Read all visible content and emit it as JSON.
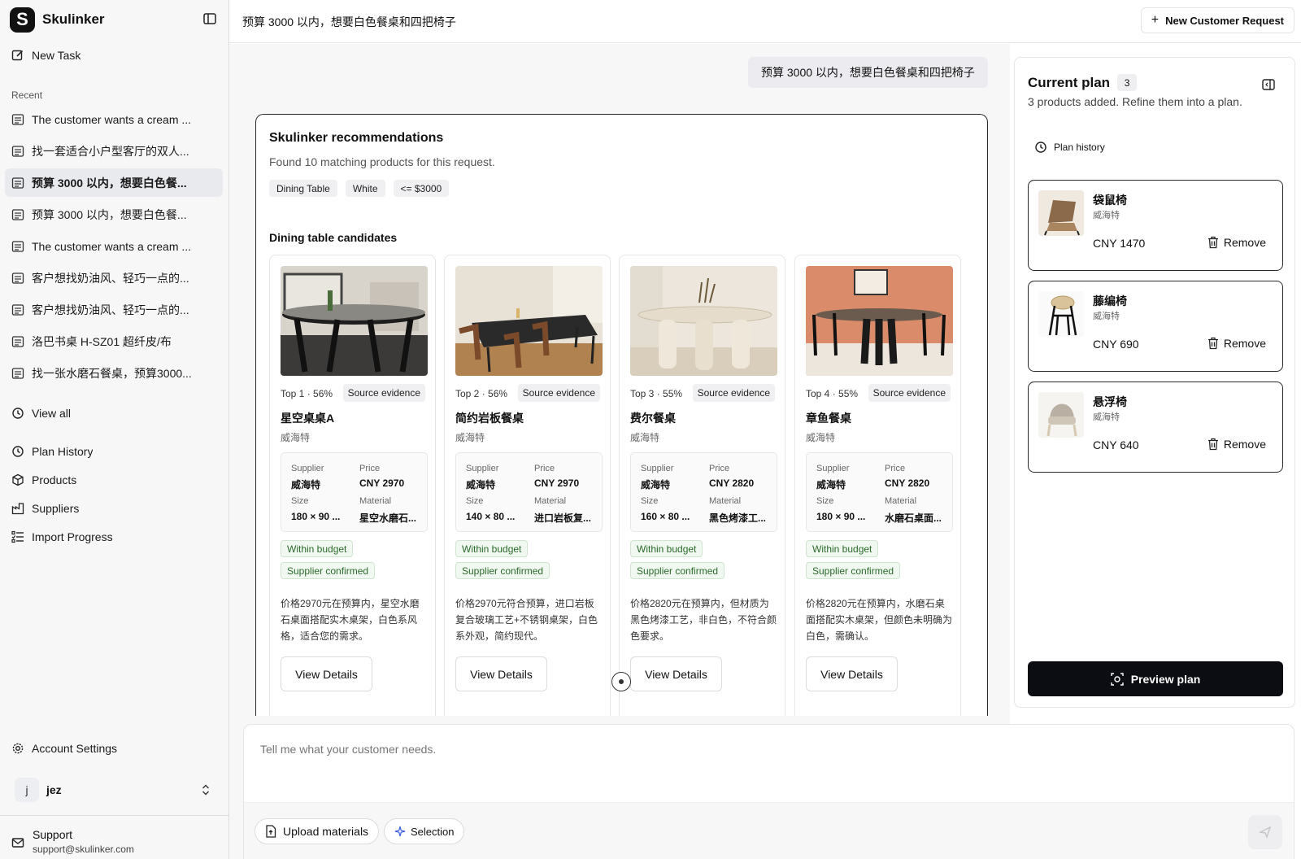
{
  "app": {
    "name": "Skulinker",
    "logo_letter": "S"
  },
  "sidebar": {
    "new_task": "New Task",
    "recent_label": "Recent",
    "recent": [
      {
        "label": "The customer wants a cream ..."
      },
      {
        "label": "找一套适合小户型客厅的双人..."
      },
      {
        "label": "预算 3000 以内，想要白色餐..."
      },
      {
        "label": "预算 3000 以内，想要白色餐..."
      },
      {
        "label": "The customer wants a cream ..."
      },
      {
        "label": "客户想找奶油风、轻巧一点的..."
      },
      {
        "label": "客户想找奶油风、轻巧一点的..."
      },
      {
        "label": "洛巴书桌 H-SZ01 超纤皮/布"
      },
      {
        "label": "找一张水磨石餐桌，预算3000..."
      }
    ],
    "view_all": "View all",
    "nav": [
      {
        "label": "Plan History",
        "icon": "history-icon"
      },
      {
        "label": "Products",
        "icon": "products-icon"
      },
      {
        "label": "Suppliers",
        "icon": "suppliers-icon"
      },
      {
        "label": "Import Progress",
        "icon": "import-icon"
      }
    ],
    "account_settings": "Account Settings",
    "user": {
      "initial": "j",
      "name": "jez"
    },
    "support": {
      "title": "Support",
      "email": "support@skulinker.com"
    }
  },
  "header": {
    "title": "预算 3000 以内，想要白色餐桌和四把椅子",
    "new_request": "New Customer Request"
  },
  "chat": {
    "user_message": "预算 3000 以内，想要白色餐桌和四把椅子"
  },
  "recommendations": {
    "title": "Skulinker recommendations",
    "subtitle": "Found 10 matching products for this request.",
    "tags": [
      "Dining Table",
      "White",
      "<= $3000"
    ],
    "section": "Dining table candidates",
    "labels": {
      "source": "Source evidence",
      "supplier": "Supplier",
      "price": "Price",
      "size": "Size",
      "material": "Material",
      "view": "View Details"
    },
    "cards": [
      {
        "rank": "Top 1 · 56%",
        "name": "星空桌桌A",
        "brand": "威海特",
        "supplier": "威海特",
        "price": "CNY 2970",
        "size": "180 × 90 ...",
        "material": "星空水磨石...",
        "badges": [
          "Within budget",
          "Supplier confirmed"
        ],
        "desc": "价格2970元在预算内，星空水磨石桌面搭配实木桌架，白色系风格，适合您的需求。"
      },
      {
        "rank": "Top 2 · 56%",
        "name": "简约岩板餐桌",
        "brand": "威海特",
        "supplier": "威海特",
        "price": "CNY 2970",
        "size": "140 × 80 ...",
        "material": "进口岩板复...",
        "badges": [
          "Within budget",
          "Supplier confirmed"
        ],
        "desc": "价格2970元符合预算，进口岩板复合玻璃工艺+不锈钢桌架，白色系外观，简约现代。"
      },
      {
        "rank": "Top 3 · 55%",
        "name": "费尔餐桌",
        "brand": "威海特",
        "supplier": "威海特",
        "price": "CNY 2820",
        "size": "160 × 80 ...",
        "material": "黑色烤漆工...",
        "badges": [
          "Within budget",
          "Supplier confirmed"
        ],
        "desc": "价格2820元在预算内，但材质为黑色烤漆工艺，非白色，不符合颜色要求。"
      },
      {
        "rank": "Top 4 · 55%",
        "name": "章鱼餐桌",
        "brand": "威海特",
        "supplier": "威海特",
        "price": "CNY 2820",
        "size": "180 × 90 ...",
        "material": "水磨石桌面...",
        "badges": [
          "Within budget",
          "Supplier confirmed"
        ],
        "desc": "价格2820元在预算内，水磨石桌面搭配实木桌架，但颜色未明确为白色，需确认。"
      }
    ]
  },
  "plan": {
    "title": "Current plan",
    "count": "3",
    "subtitle": "3 products added. Refine them into a plan.",
    "history": "Plan history",
    "remove_label": "Remove",
    "items": [
      {
        "name": "袋鼠椅",
        "brand": "威海特",
        "price": "CNY 1470"
      },
      {
        "name": "藤编椅",
        "brand": "威海特",
        "price": "CNY 690"
      },
      {
        "name": "悬浮椅",
        "brand": "威海特",
        "price": "CNY 640"
      }
    ],
    "preview": "Preview plan"
  },
  "composer": {
    "placeholder": "Tell me what your customer needs.",
    "upload": "Upload materials",
    "selection": "Selection"
  },
  "colors": {
    "accent": "#0c0d12",
    "badge_green": "#2b6a2b",
    "sidebar_bg": "#f7f7f8"
  }
}
